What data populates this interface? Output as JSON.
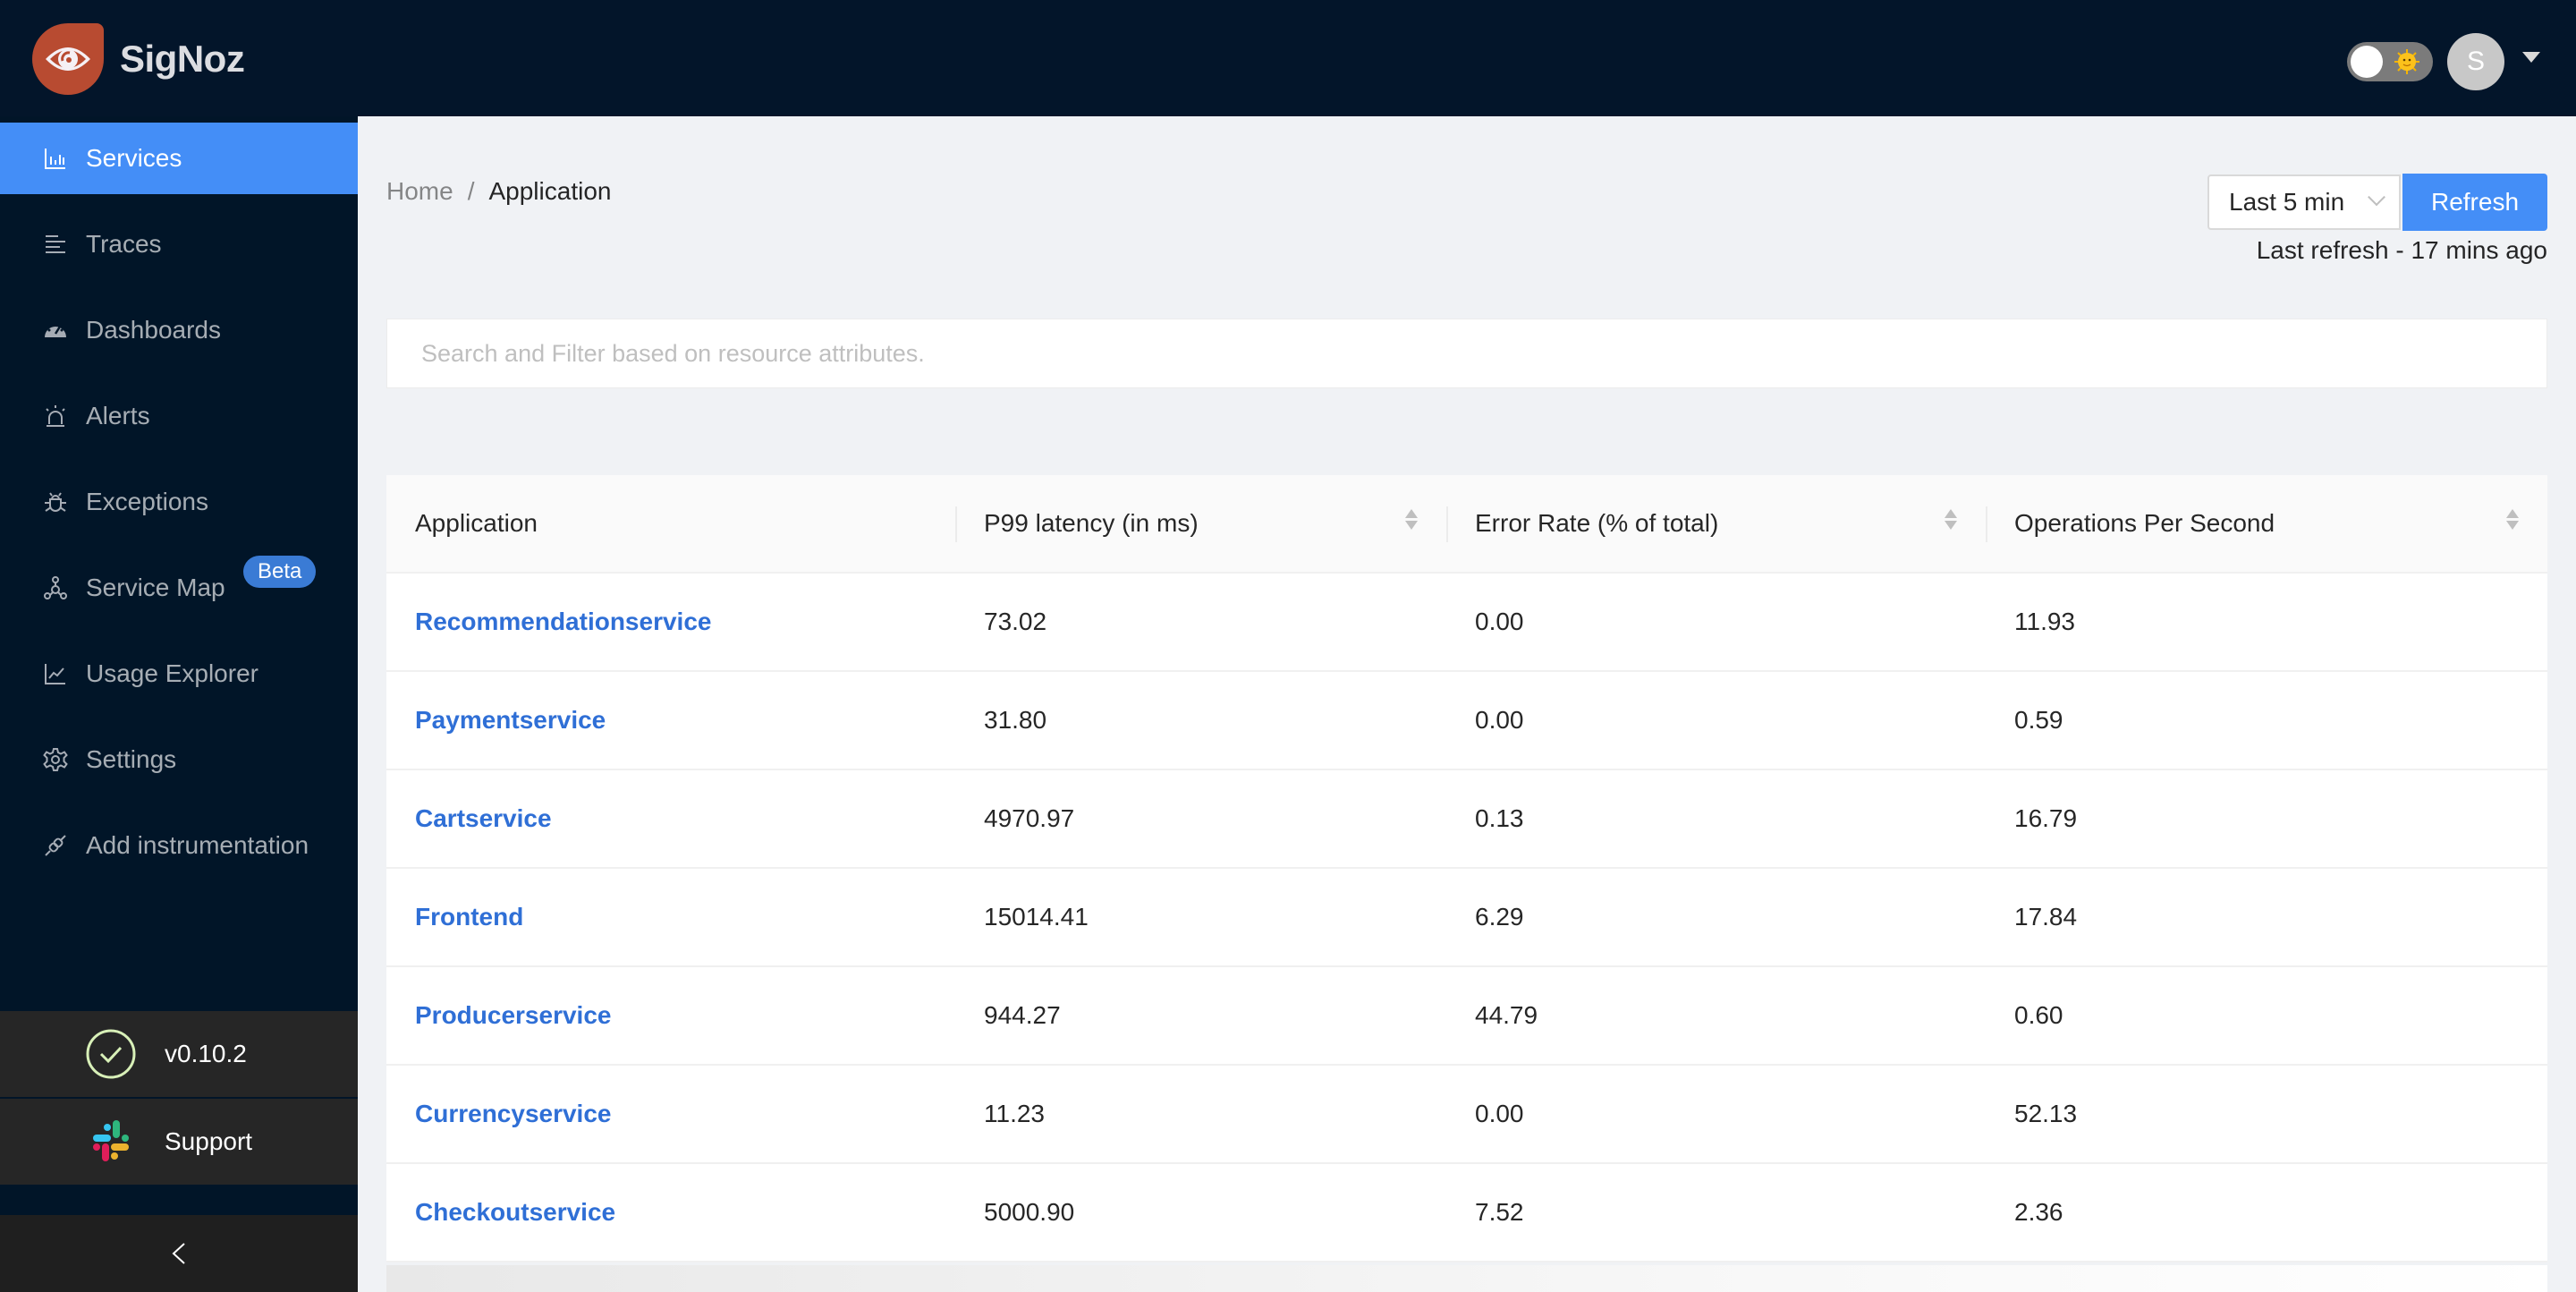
{
  "header": {
    "brand": "SigNoz",
    "theme_toggle_icon": "sun-icon",
    "avatar_initial": "S"
  },
  "sidebar": {
    "items": [
      {
        "label": "Services",
        "icon": "bar-chart-icon",
        "active": true
      },
      {
        "label": "Traces",
        "icon": "align-left-icon",
        "active": false
      },
      {
        "label": "Dashboards",
        "icon": "dashboard-gauge-icon",
        "active": false
      },
      {
        "label": "Alerts",
        "icon": "alarm-icon",
        "active": false
      },
      {
        "label": "Exceptions",
        "icon": "bug-icon",
        "active": false
      },
      {
        "label": "Service Map",
        "icon": "deployment-unit-icon",
        "active": false,
        "badge": "Beta"
      },
      {
        "label": "Usage Explorer",
        "icon": "line-chart-icon",
        "active": false
      },
      {
        "label": "Settings",
        "icon": "gear-icon",
        "active": false
      },
      {
        "label": "Add instrumentation",
        "icon": "api-plug-icon",
        "active": false
      }
    ],
    "version": "v0.10.2",
    "support_label": "Support",
    "collapse_icon": "chevron-left-icon"
  },
  "breadcrumb": {
    "home": "Home",
    "separator": "/",
    "current": "Application"
  },
  "toolbar": {
    "time_range": "Last 5 min",
    "refresh_label": "Refresh",
    "last_refresh": "Last refresh - 17 mins ago"
  },
  "search": {
    "placeholder": "Search and Filter based on resource attributes.",
    "value": ""
  },
  "table": {
    "columns": [
      {
        "label": "Application",
        "sortable": false
      },
      {
        "label": "P99 latency (in ms)",
        "sortable": true
      },
      {
        "label": "Error Rate (% of total)",
        "sortable": true
      },
      {
        "label": "Operations Per Second",
        "sortable": true
      }
    ],
    "rows": [
      {
        "application": "Recommendationservice",
        "p99": "73.02",
        "error_rate": "0.00",
        "ops": "11.93"
      },
      {
        "application": "Paymentservice",
        "p99": "31.80",
        "error_rate": "0.00",
        "ops": "0.59"
      },
      {
        "application": "Cartservice",
        "p99": "4970.97",
        "error_rate": "0.13",
        "ops": "16.79"
      },
      {
        "application": "Frontend",
        "p99": "15014.41",
        "error_rate": "6.29",
        "ops": "17.84"
      },
      {
        "application": "Producerservice",
        "p99": "944.27",
        "error_rate": "44.79",
        "ops": "0.60"
      },
      {
        "application": "Currencyservice",
        "p99": "11.23",
        "error_rate": "0.00",
        "ops": "52.13"
      },
      {
        "application": "Checkoutservice",
        "p99": "5000.90",
        "error_rate": "7.52",
        "ops": "2.36"
      }
    ]
  },
  "colors": {
    "header_bg": "#03152a",
    "sidebar_bg": "#011528",
    "accent": "#448ef7",
    "link": "#2f6fd6",
    "brand_logo": "#b84b31"
  }
}
